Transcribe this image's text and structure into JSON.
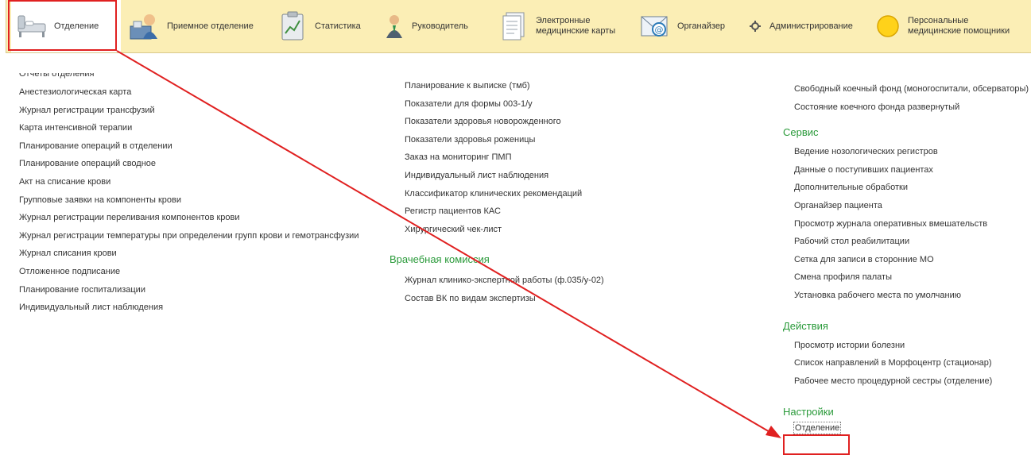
{
  "topbar": {
    "sections": [
      {
        "label": "Отделение",
        "icon": "department-icon"
      },
      {
        "label": "Приемное отделение",
        "icon": "reception-icon"
      },
      {
        "label": "Статистика",
        "icon": "statistics-icon"
      },
      {
        "label": "Руководитель",
        "icon": "manager-icon"
      },
      {
        "label": "Электронные\nмедицинские карты",
        "icon": "medical-cards-icon"
      },
      {
        "label": "Органайзер",
        "icon": "organizer-icon"
      },
      {
        "label": "Администрирование",
        "icon": "gear-icon"
      },
      {
        "label": "Персональные\nмедицинские помощники",
        "icon": "assistant-icon"
      }
    ]
  },
  "columns": {
    "left": {
      "cut_off_item": "Отчеты отделения",
      "items": [
        "Анестезиологическая карта",
        "Журнал регистрации трансфузий",
        "Карта интенсивной терапии",
        "Планирование операций в отделении",
        "Планирование операций сводное",
        "Акт на списание крови",
        "Групповые заявки на компоненты крови",
        "Журнал регистрации переливания компонентов крови",
        "Журнал регистрации температуры при определении групп крови и гемотрансфузии",
        "Журнал списания крови",
        "Отложенное подписание",
        "Планирование госпитализации",
        "Индивидуальный лист наблюдения"
      ]
    },
    "middle": {
      "items": [
        "Планирование к выписке (тмб)",
        "Показатели для формы 003-1/у",
        "Показатели здоровья новорожденного",
        "Показатели здоровья роженицы",
        "Заказ на мониторинг ПМП",
        "Индивидуальный лист наблюдения",
        "Классификатор клинических рекомендаций",
        "Регистр пациентов КАС",
        "Хирургический чек-лист"
      ],
      "group_title": "Врачебная комиссия",
      "group_items": [
        "Журнал клинико-экспертной работы (ф.035/у-02)",
        "Состав ВК по видам экспертизы"
      ]
    },
    "right": {
      "items": [
        "Свободный коечный фонд (моногоспитали, обсерваторы)",
        "Состояние коечного фонда развернутый"
      ],
      "service_title": "Сервис",
      "service_items": [
        "Ведение нозологических регистров",
        "Данные о поступивших пациентах",
        "Дополнительные обработки",
        "Органайзер пациента",
        "Просмотр журнала оперативных вмешательств",
        "Рабочий стол реабилитации",
        "Сетка для записи в сторонние МО",
        "Смена профиля палаты",
        "Установка рабочего места по умолчанию"
      ],
      "actions_title": "Действия",
      "actions_items": [
        "Просмотр истории болезни",
        "Список направлений в Морфоцентр (стационар)",
        "Рабочее место процедурной сестры (отделение)"
      ],
      "settings_title": "Настройки",
      "settings_items": [
        "Отделение"
      ]
    }
  },
  "colors": {
    "topbar_bg": "#fbeeb5",
    "group_title": "#2a9a3a",
    "highlight": "#e02020"
  }
}
